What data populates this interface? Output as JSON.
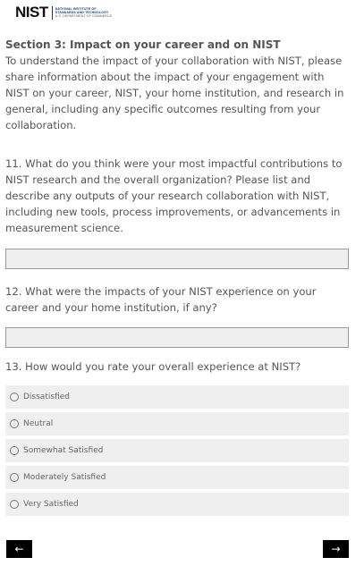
{
  "logo": {
    "mark": "NIST",
    "line1": "NATIONAL INSTITUTE OF",
    "line2": "STANDARDS AND TECHNOLOGY",
    "line3": "U.S. DEPARTMENT OF COMMERCE"
  },
  "section": {
    "title": "Section 3: Impact on your career and on NIST",
    "description": "To understand the impact of your collaboration with NIST, please share information about the impact of your engagement with NIST on your career, NIST, your home institution, and research in general, including any specific outcomes resulting from your collaboration."
  },
  "questions": {
    "q11": {
      "text": "11. What do you think were your most impactful contributions to NIST research and the overall organization? Please list and describe any outputs of your research collaboration with NIST, including new tools, process improvements, or advancements in measurement science.",
      "value": ""
    },
    "q12": {
      "text": "12. What were the impacts of your NIST experience on your career and your home institution, if any?",
      "value": ""
    },
    "q13": {
      "text": "13. How would you rate your overall experience at NIST?",
      "options": [
        {
          "label": "Dissatisfied",
          "selected": false
        },
        {
          "label": "Neutral",
          "selected": false
        },
        {
          "label": "Somewhat Satisfied",
          "selected": false
        },
        {
          "label": "Moderately Satisfied",
          "selected": false
        },
        {
          "label": "Very Satisfied",
          "selected": false
        }
      ]
    }
  },
  "navigation": {
    "prev_label": "←",
    "next_label": "→"
  },
  "colors": {
    "text": "#555555",
    "field_background": "#efefef",
    "field_border": "#999999",
    "button_background": "#000000",
    "button_text": "#ffffff",
    "logo_blue": "#1d3d7a"
  }
}
